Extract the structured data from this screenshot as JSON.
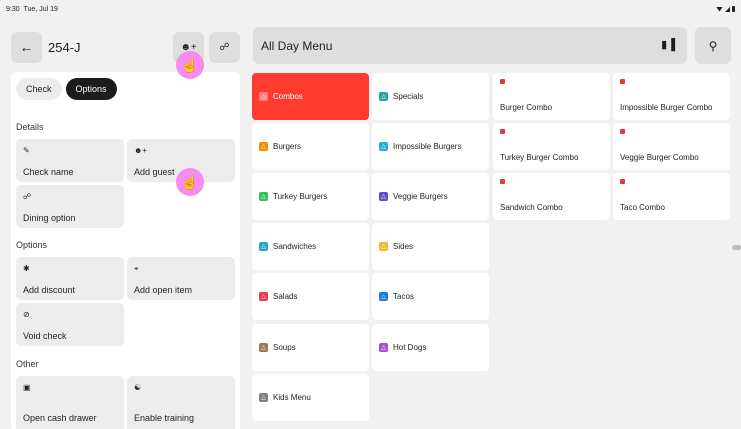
{
  "status_bar": {
    "time": "9:30",
    "date": "Tue, Jul 19"
  },
  "header": {
    "check_number": "254-J"
  },
  "segmented": {
    "tabs": [
      "Check",
      "Options"
    ],
    "active": "Options"
  },
  "sections": {
    "details": {
      "title": "Details",
      "tiles": [
        {
          "label": "Check name",
          "icon": "pencil-icon"
        },
        {
          "label": "Add guest",
          "icon": "add-guest-icon"
        },
        {
          "label": "Dining option",
          "icon": "dining-icon"
        }
      ]
    },
    "options": {
      "title": "Options",
      "tiles": [
        {
          "label": "Add discount",
          "icon": "discount-icon"
        },
        {
          "label": "Add open item",
          "icon": "cart-add-icon"
        },
        {
          "label": "Void check",
          "icon": "void-icon"
        }
      ]
    },
    "other": {
      "title": "Other",
      "tiles": [
        {
          "label": "Open cash drawer",
          "icon": "cash-drawer-icon"
        },
        {
          "label": "Enable training",
          "icon": "training-icon"
        }
      ]
    }
  },
  "menu": {
    "title": "All Day Menu"
  },
  "categories": [
    {
      "label": "Combos",
      "color": "#ff3b30",
      "selected": true
    },
    {
      "label": "Specials",
      "color": "#26a69a"
    },
    {
      "label": "Burgers",
      "color": "#fb8c00"
    },
    {
      "label": "Impossible Burgers",
      "color": "#29a9e0"
    },
    {
      "label": "Turkey Burgers",
      "color": "#34c05a"
    },
    {
      "label": "Veggie Burgers",
      "color": "#5c4fc9"
    },
    {
      "label": "Sandwiches",
      "color": "#26a6c9"
    },
    {
      "label": "Sides",
      "color": "#f2b82b"
    },
    {
      "label": "Salads",
      "color": "#f2334d"
    },
    {
      "label": "Tacos",
      "color": "#1e7be0"
    },
    {
      "label": "Soups",
      "color": "#a0784a"
    },
    {
      "label": "Hot Dogs",
      "color": "#a64fd6"
    },
    {
      "label": "Kids Menu",
      "color": "#808080"
    }
  ],
  "items": [
    {
      "label": "Burger Combo"
    },
    {
      "label": "Impossible Burger Combo"
    },
    {
      "label": "Turkey Burger Combo"
    },
    {
      "label": "Veggie Burger Combo"
    },
    {
      "label": "Sandwich Combo"
    },
    {
      "label": "Taco Combo"
    }
  ],
  "accent_color": "#ff3b30",
  "touch_color": "#f58cf0"
}
